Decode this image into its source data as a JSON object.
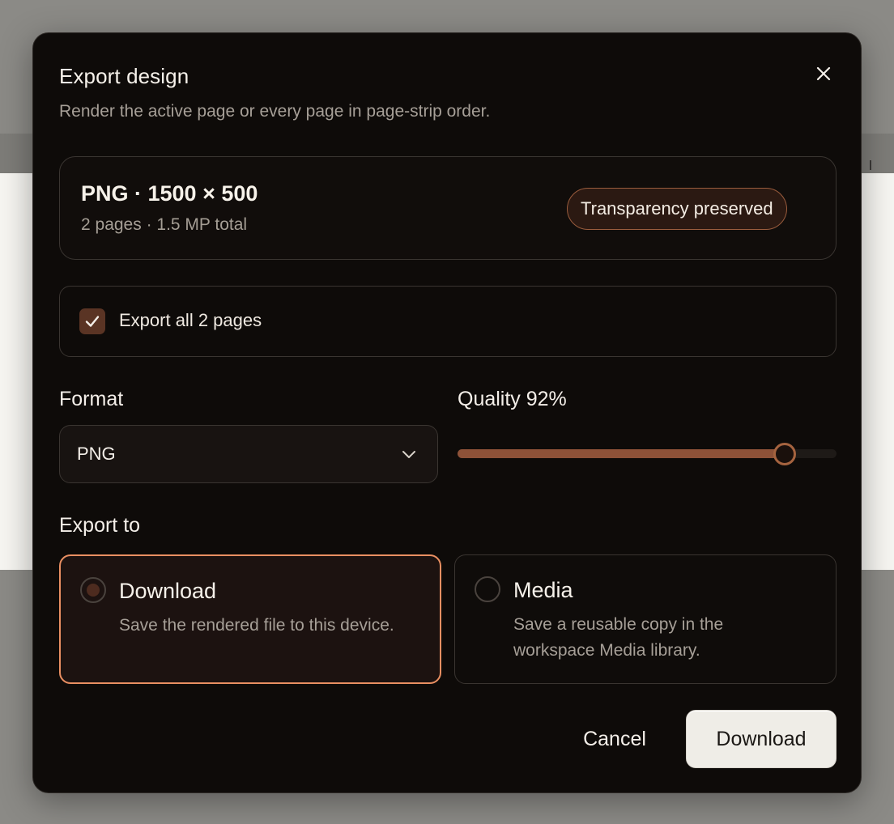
{
  "dialog": {
    "title": "Export design",
    "subtitle": "Render the active page or every page in page-strip order."
  },
  "summary": {
    "headline": "PNG · 1500 × 500",
    "details": "2 pages · 1.5 MP total",
    "badge": "Transparency preserved"
  },
  "export_all": {
    "label": "Export all 2 pages",
    "checked": true
  },
  "format": {
    "label": "Format",
    "selected": "PNG"
  },
  "quality": {
    "label": "Quality 92%",
    "value": 92
  },
  "export_to": {
    "label": "Export to",
    "options": [
      {
        "title": "Download",
        "description": "Save the rendered file to this device.",
        "selected": true
      },
      {
        "title": "Media",
        "description": "Save a reusable copy in the workspace Media library.",
        "selected": false
      }
    ]
  },
  "actions": {
    "cancel": "Cancel",
    "confirm": "Download"
  },
  "icons": {
    "close": "close-icon",
    "check": "check-icon",
    "chevron": "chevron-down-icon"
  },
  "colors": {
    "accent": "#e98f62",
    "slider_fill": "#8e5238",
    "badge_border": "#9a5c3d",
    "dialog_bg": "#0e0b09"
  }
}
